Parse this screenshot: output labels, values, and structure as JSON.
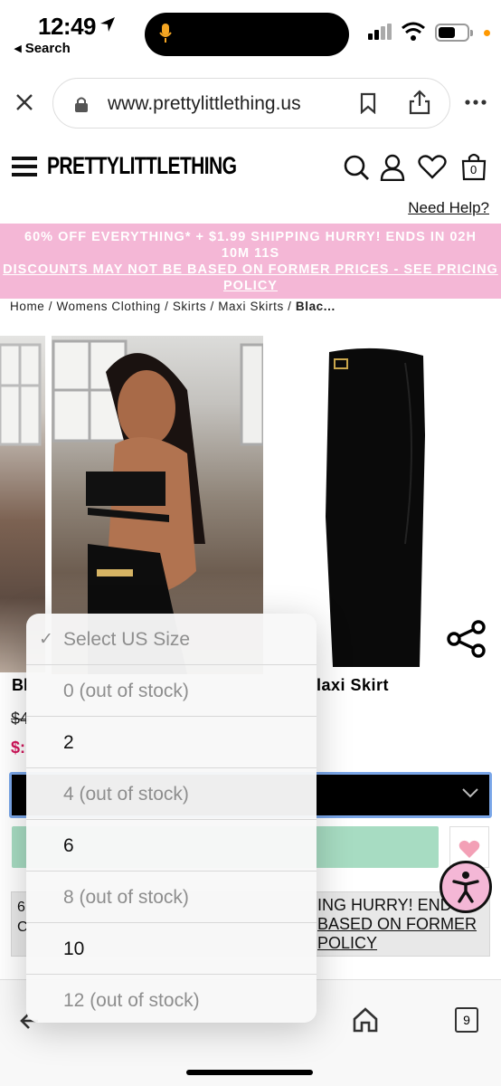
{
  "status_bar": {
    "time": "12:49",
    "back_label": "◂ Search"
  },
  "browser": {
    "url": "www.prettylittlething.us",
    "tab_count": "9"
  },
  "site": {
    "logo": "PRETTYLITTLETHING",
    "cart_count": "0",
    "need_help": "Need Help?"
  },
  "promo": {
    "line1": "60% OFF EVERYTHING* + $1.99 SHIPPING HURRY! ENDS IN 02H",
    "line2": "10M 11S",
    "line3": "DISCOUNTS MAY NOT BE BASED ON FORMER PRICES - SEE PRICING",
    "line4": "POLICY"
  },
  "breadcrumb": {
    "text": "Home / Womens Clothing / Skirts / Maxi Skirts / ",
    "current": "Blac..."
  },
  "product": {
    "title_left_fragment": "Bl",
    "title_right_fragment": "laxi Skirt",
    "old_price_fragment": "$4",
    "new_price_fragment": "$:"
  },
  "info_box": {
    "left_line1": "6",
    "left_line2": "C",
    "right_line1": "ING HURRY! ENDS",
    "right_line2": "BASED ON FORMER",
    "right_line3": "POLICY"
  },
  "size_dropdown": {
    "options": [
      {
        "label": "Select US Size",
        "state": "header"
      },
      {
        "label": "0 (out of stock)",
        "state": "out"
      },
      {
        "label": "2",
        "state": "in"
      },
      {
        "label": "4 (out of stock)",
        "state": "out"
      },
      {
        "label": "6",
        "state": "in"
      },
      {
        "label": "8 (out of stock)",
        "state": "out"
      },
      {
        "label": "10",
        "state": "in"
      },
      {
        "label": "12 (out of stock)",
        "state": "out"
      }
    ],
    "check_mark": "✓"
  },
  "colors": {
    "promo_pink": "#f4b7d6",
    "sale_red": "#d2145a",
    "add_to_bag_green": "#a7dcc2",
    "select_focus_blue": "#7aa6e8"
  },
  "icons": [
    "location-arrow-icon",
    "microphone-icon",
    "signal-icon",
    "wifi-icon",
    "battery-icon",
    "close-icon",
    "lock-icon",
    "bookmark-icon",
    "share-icon",
    "more-icon",
    "menu-icon",
    "search-icon",
    "account-icon",
    "heart-icon",
    "bag-icon",
    "share-nodes-icon",
    "chevron-down-icon",
    "accessibility-icon",
    "back-arrow-icon",
    "home-icon",
    "tabs-icon"
  ]
}
